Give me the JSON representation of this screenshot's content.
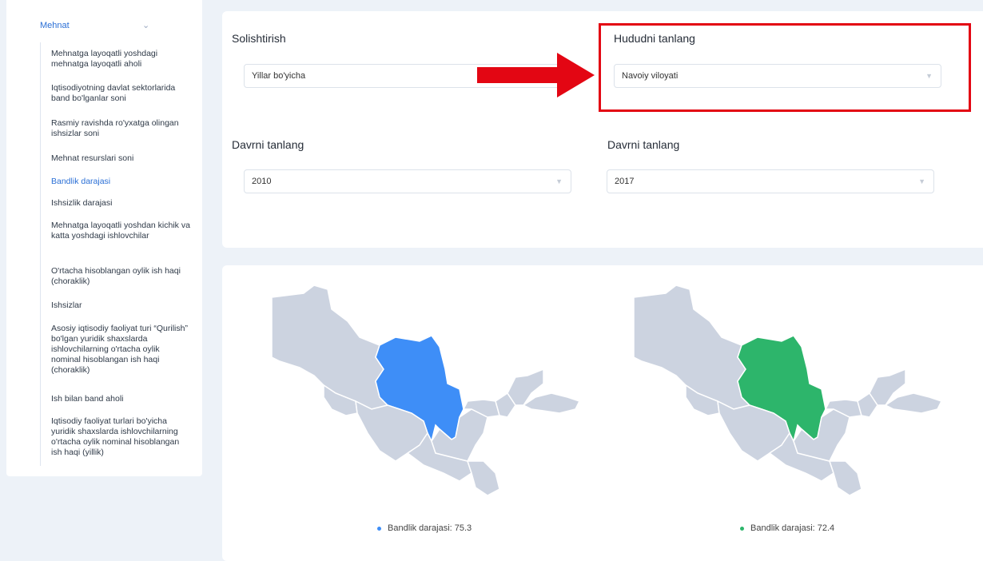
{
  "sidebar": {
    "category": "Mehnat",
    "items": [
      {
        "label": "Mehnatga layoqatli yoshdagi mehnatga layoqatli aholi",
        "active": false
      },
      {
        "label": "Iqtisodiyotning davlat sektorlarida band bo'lganlar soni",
        "active": false
      },
      {
        "label": "Rasmiy ravishda ro'yxatga olingan ishsizlar soni",
        "active": false
      },
      {
        "label": "Mehnat resurslari soni",
        "active": false
      },
      {
        "label": "Bandlik darajasi",
        "active": true
      },
      {
        "label": "Ishsizlik darajasi",
        "active": false
      },
      {
        "label": "Mehnatga layoqatli yoshdan kichik va katta yoshdagi ishlovchilar",
        "active": false
      },
      {
        "label": "O'rtacha hisoblangan oylik ish haqi (choraklik)",
        "active": false
      },
      {
        "label": "Ishsizlar",
        "active": false
      },
      {
        "label": "Asosiy iqtisodiy faoliyat turi “Qurilish” bo'lgan yuridik shaxslarda ishlovchilarning o'rtacha oylik nominal hisoblangan ish haqi (choraklik)",
        "active": false
      },
      {
        "label": "Ish bilan band aholi",
        "active": false
      },
      {
        "label": "Iqtisodiy faoliyat turlari bo'yicha yuridik shaxslarda ishlovchilarning o'rtacha oylik nominal hisoblangan ish haqi (yillik)",
        "active": false
      }
    ]
  },
  "filters": {
    "compare_label": "Solishtirish",
    "compare_value": "Yillar bo'yicha",
    "region_label": "Hududni tanlang",
    "region_value": "Navoiy viloyati",
    "period1_label": "Davrni tanlang",
    "period1_value": "2010",
    "period2_label": "Davrni tanlang",
    "period2_value": "2017"
  },
  "maps": [
    {
      "legend": "Bandlik darajasi: 75.3",
      "color": "#3e8ef7"
    },
    {
      "legend": "Bandlik darajasi: 72.4",
      "color": "#2db56b"
    }
  ],
  "colors": {
    "accent": "#2a6fd6",
    "highlight": "#e30613",
    "region_base": "#ccd3e0",
    "region_border": "#ffffff"
  }
}
